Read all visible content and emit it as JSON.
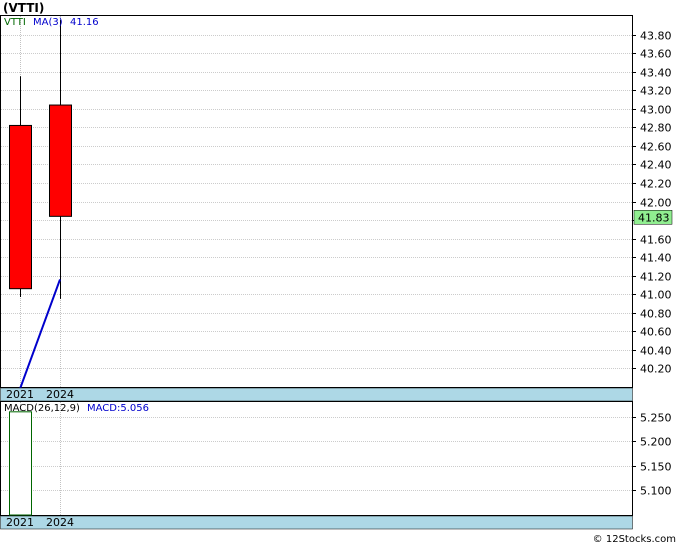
{
  "chart_title": "(VTTI)",
  "watermark": "© 12Stocks.com",
  "colors": {
    "candle": "#ff0000",
    "ma": "#0000cc",
    "legend_green": "#006600",
    "axis_band": "#add8e6",
    "grid": "#999999",
    "price_box": "#90ee90",
    "macd_bar": "#006600"
  },
  "chart_data": [
    {
      "type": "candlestick",
      "symbol": "VTTI",
      "x_labels": [
        "2021",
        "2024"
      ],
      "candles": [
        {
          "x": "2021",
          "open": 41.06,
          "high": 43.35,
          "low": 40.97,
          "close": 42.82
        },
        {
          "x": "2024",
          "open": 41.84,
          "high": 43.96,
          "low": 40.95,
          "close": 43.04
        }
      ],
      "ma": {
        "label": "MA(3)",
        "value_label": "41.16",
        "points": [
          {
            "x": "2021",
            "y": 39.98
          },
          {
            "x": "2024",
            "y": 41.16
          }
        ]
      },
      "y_ticks": [
        40.2,
        40.4,
        40.6,
        40.8,
        41.0,
        41.2,
        41.4,
        41.6,
        41.8,
        42.0,
        42.2,
        42.4,
        42.6,
        42.8,
        43.0,
        43.2,
        43.4,
        43.6,
        43.8
      ],
      "y_tick_labels": [
        "40.20",
        "40.40",
        "40.60",
        "40.80",
        "41.00",
        "41.20",
        "41.40",
        "41.60",
        "41.80",
        "42.00",
        "42.20",
        "42.40",
        "42.60",
        "42.80",
        "43.00",
        "43.20",
        "43.40",
        "43.60",
        "43.80"
      ],
      "ylim": [
        40.0,
        44.0
      ],
      "last_price": "41.83",
      "last_price_value": 41.83,
      "grid": true
    },
    {
      "type": "bar",
      "name": "MACD(26,12,9)",
      "value_label": "MACD:5.056",
      "x_labels": [
        "2021",
        "2024"
      ],
      "values": [
        5.26,
        null
      ],
      "y_ticks": [
        5.1,
        5.15,
        5.2,
        5.25
      ],
      "y_tick_labels": [
        "5.100",
        "5.150",
        "5.200",
        "5.250"
      ],
      "ylim": [
        5.05,
        5.28
      ],
      "grid": true
    }
  ]
}
